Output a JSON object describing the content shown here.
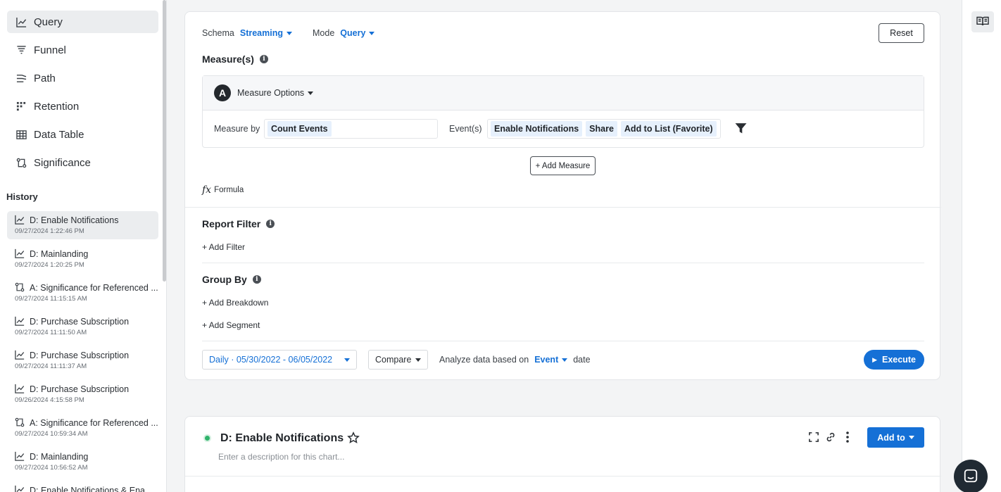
{
  "sidebar": {
    "nav": [
      {
        "label": "Query",
        "icon": "line-chart-icon",
        "active": true
      },
      {
        "label": "Funnel",
        "icon": "funnel-icon",
        "active": false
      },
      {
        "label": "Path",
        "icon": "path-icon",
        "active": false
      },
      {
        "label": "Retention",
        "icon": "retention-icon",
        "active": false
      },
      {
        "label": "Data Table",
        "icon": "table-icon",
        "active": false
      },
      {
        "label": "Significance",
        "icon": "significance-icon",
        "active": false
      }
    ],
    "history_title": "History",
    "history": [
      {
        "label": "D: Enable Notifications",
        "date": "09/27/2024 1:22:46 PM",
        "icon": "line-chart-icon"
      },
      {
        "label": "D: Mainlanding",
        "date": "09/27/2024 1:20:25 PM",
        "icon": "line-chart-icon"
      },
      {
        "label": "A: Significance for Referenced ...",
        "date": "09/27/2024 11:15:15 AM",
        "icon": "significance-icon"
      },
      {
        "label": "D: Purchase Subscription",
        "date": "09/27/2024 11:11:50 AM",
        "icon": "line-chart-icon"
      },
      {
        "label": "D: Purchase Subscription",
        "date": "09/27/2024 11:11:37 AM",
        "icon": "line-chart-icon"
      },
      {
        "label": "D: Purchase Subscription",
        "date": "09/26/2024 4:15:58 PM",
        "icon": "line-chart-icon"
      },
      {
        "label": "A: Significance for Referenced ...",
        "date": "09/27/2024 10:59:34 AM",
        "icon": "significance-icon"
      },
      {
        "label": "D: Mainlanding",
        "date": "09/27/2024 10:56:52 AM",
        "icon": "line-chart-icon"
      },
      {
        "label": "D: Enable Notifications & Ena...",
        "date": "",
        "icon": "line-chart-icon"
      }
    ]
  },
  "query": {
    "schema_label": "Schema",
    "schema_value": "Streaming",
    "mode_label": "Mode",
    "mode_value": "Query",
    "reset_label": "Reset",
    "measures_title": "Measure(s)",
    "measure_avatar": "A",
    "measure_options": "Measure Options",
    "measure_by_label": "Measure by",
    "measure_by_value": "Count Events",
    "events_label": "Event(s)",
    "events": [
      "Enable Notifications",
      "Share",
      "Add to List (Favorite)"
    ],
    "add_measure": "+ Add Measure",
    "formula_icon": "fx",
    "formula_label": "Formula",
    "report_filter_title": "Report Filter",
    "add_filter": "+ Add Filter",
    "group_by_title": "Group By",
    "add_breakdown": "+ Add Breakdown",
    "add_segment": "+ Add Segment",
    "date_range": "Daily · 05/30/2022 - 06/05/2022",
    "compare_label": "Compare",
    "analyze_label": "Analyze data based on",
    "analyze_value": "Event",
    "analyze_suffix": "date",
    "execute_label": "Execute"
  },
  "chart": {
    "title": "D: Enable Notifications",
    "description_placeholder": "Enter a description for this chart...",
    "add_to_label": "Add to"
  },
  "colors": {
    "accent": "#1570d6",
    "status_dot": "#2fb36b"
  }
}
